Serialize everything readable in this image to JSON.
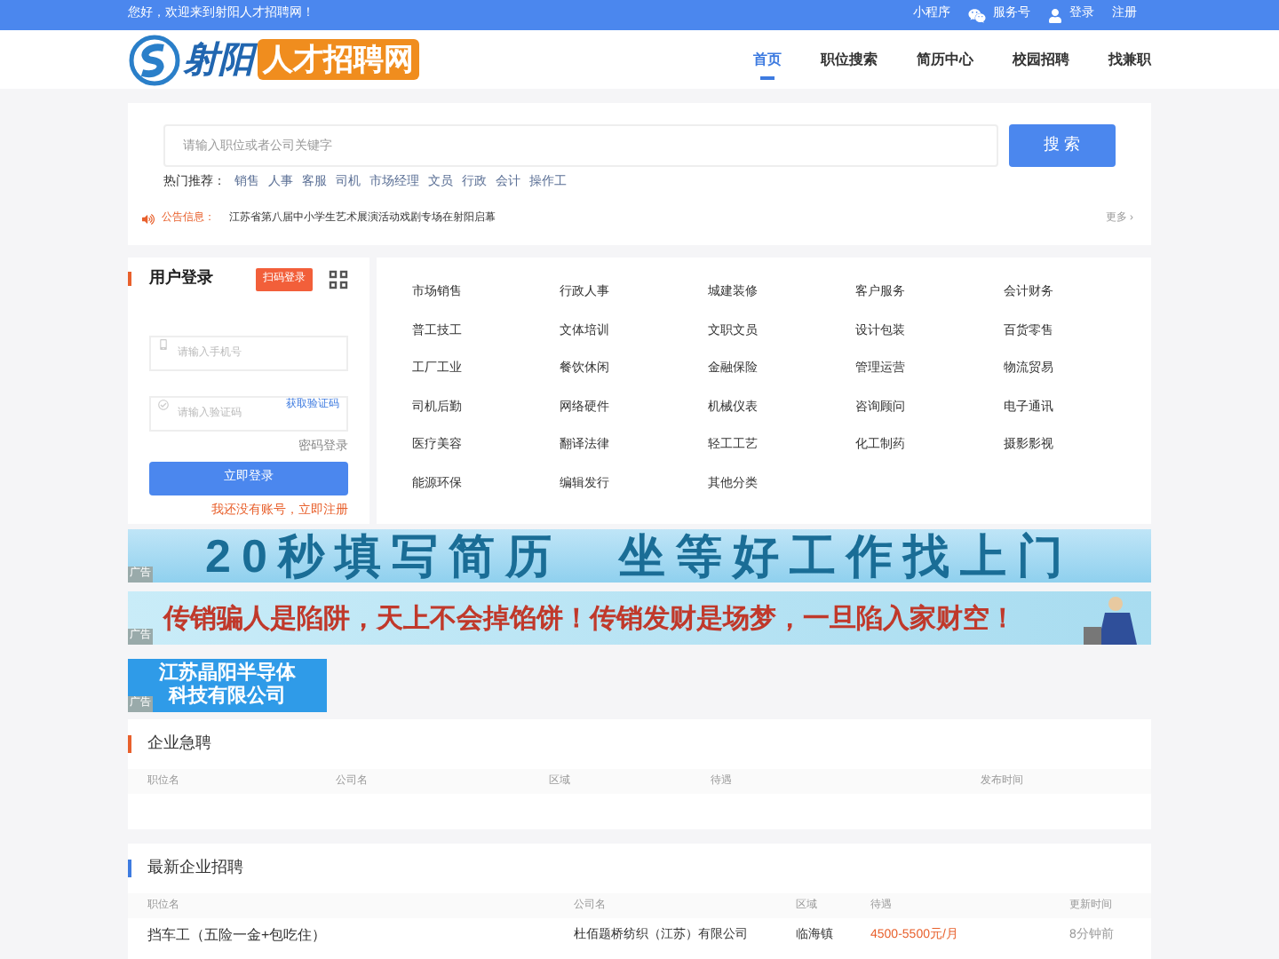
{
  "top_bar": {
    "greeting": "您好，欢迎来到射阳人才招聘网！",
    "links": [
      {
        "kind": "text",
        "label": "小程序"
      },
      {
        "kind": "wechat",
        "label": "服务号"
      },
      {
        "kind": "user",
        "label": "登录"
      },
      {
        "kind": "text",
        "label": "注册"
      }
    ]
  },
  "header": {
    "logo_main": "射阳",
    "logo_tag": "人才招聘网",
    "nav": [
      {
        "label": "首页",
        "selected": true
      },
      {
        "label": "职位搜索",
        "selected": false
      },
      {
        "label": "简历中心",
        "selected": false
      },
      {
        "label": "校园招聘",
        "selected": false
      },
      {
        "label": "找兼职",
        "selected": false
      }
    ]
  },
  "search": {
    "placeholder": "请输入职位或者公司关键字",
    "button": "搜 索",
    "hot_label": "热门推荐：",
    "hot": [
      "销售",
      "人事",
      "客服",
      "司机",
      "市场经理",
      "文员",
      "行政",
      "会计",
      "操作工"
    ],
    "notice_label": "公告信息：",
    "notice": "江苏省第八届中小学生艺术展演活动戏剧专场在射阳启幕",
    "more": "更多 ›"
  },
  "login": {
    "title": "用户登录",
    "scan": "扫码登录",
    "phone_placeholder": "请输入手机号",
    "code_placeholder": "请输入验证码",
    "get_code": "获取验证码",
    "password_login": "密码登录",
    "submit": "立即登录",
    "register": "我还没有账号，立即注册"
  },
  "categories": [
    "市场销售",
    "行政人事",
    "城建装修",
    "客户服务",
    "会计财务",
    "普工技工",
    "文体培训",
    "文职文员",
    "设计包装",
    "百货零售",
    "工厂工业",
    "餐饮休闲",
    "金融保险",
    "管理运营",
    "物流贸易",
    "司机后勤",
    "网络硬件",
    "机械仪表",
    "咨询顾问",
    "电子通讯",
    "医疗美容",
    "翻译法律",
    "轻工工艺",
    "化工制药",
    "摄影影视",
    "能源环保",
    "编辑发行",
    "其他分类"
  ],
  "banners": [
    {
      "kind": "wide",
      "text": "20秒填写简历　坐等好工作找上门",
      "ad": "广告"
    },
    {
      "kind": "warning",
      "text": "传销骗人是陷阱，天上不会掉馅饼！传销发财是场梦，一旦陷入家财空！",
      "ad": "广告"
    },
    {
      "kind": "small",
      "text": "江苏晶阳半导体科技有限公司",
      "ad": "广告"
    }
  ],
  "urgent": {
    "title": "企业急聘",
    "columns": [
      "职位名",
      "公司名",
      "区域",
      "待遇",
      "发布时间"
    ]
  },
  "latest": {
    "title": "最新企业招聘",
    "columns": [
      "职位名",
      "公司名",
      "区域",
      "待遇",
      "更新时间"
    ],
    "rows": [
      {
        "job": "挡车工（五险一金+包吃住）",
        "company": "杜佰题桥纺织（江苏）有限公司",
        "area": "临海镇",
        "pay": "4500-5500元/月",
        "time": "8分钟前"
      }
    ]
  }
}
